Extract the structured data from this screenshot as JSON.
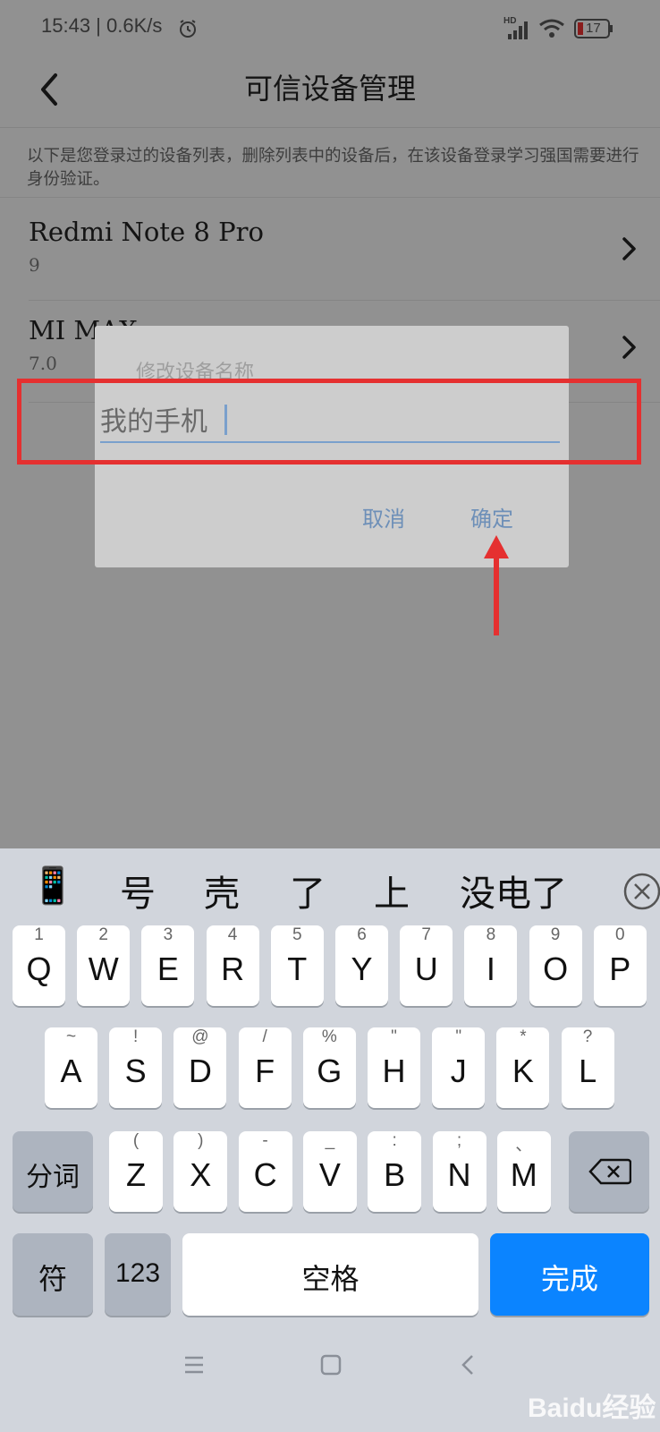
{
  "status_bar": {
    "time": "15:43 | 0.6K/s",
    "battery": "17",
    "network": "HD"
  },
  "header": {
    "title": "可信设备管理"
  },
  "notice": "以下是您登录过的设备列表，删除列表中的设备后，在该设备登录学习强国需要进行身份验证。",
  "devices": [
    {
      "name": "Redmi Note 8 Pro",
      "version": "9"
    },
    {
      "name": "MI MAX",
      "version": "7.0"
    }
  ],
  "dialog": {
    "title": "修改设备名称",
    "input_value": "我的手机",
    "cancel_label": "取消",
    "ok_label": "确定"
  },
  "keyboard": {
    "candidates": [
      "📱",
      "号",
      "壳",
      "了",
      "上",
      "没电了"
    ],
    "row1": [
      {
        "k": "Q",
        "s": "1"
      },
      {
        "k": "W",
        "s": "2"
      },
      {
        "k": "E",
        "s": "3"
      },
      {
        "k": "R",
        "s": "4"
      },
      {
        "k": "T",
        "s": "5"
      },
      {
        "k": "Y",
        "s": "6"
      },
      {
        "k": "U",
        "s": "7"
      },
      {
        "k": "I",
        "s": "8"
      },
      {
        "k": "O",
        "s": "9"
      },
      {
        "k": "P",
        "s": "0"
      }
    ],
    "row2": [
      {
        "k": "A",
        "s": "~"
      },
      {
        "k": "S",
        "s": "!"
      },
      {
        "k": "D",
        "s": "@"
      },
      {
        "k": "F",
        "s": "/"
      },
      {
        "k": "G",
        "s": "%"
      },
      {
        "k": "H",
        "s": "\""
      },
      {
        "k": "J",
        "s": "\""
      },
      {
        "k": "K",
        "s": "*"
      },
      {
        "k": "L",
        "s": "?"
      }
    ],
    "row3": [
      {
        "k": "Z",
        "s": "("
      },
      {
        "k": "X",
        "s": ")"
      },
      {
        "k": "C",
        "s": "-"
      },
      {
        "k": "V",
        "s": "_"
      },
      {
        "k": "B",
        "s": ":"
      },
      {
        "k": "N",
        "s": ";"
      },
      {
        "k": "M",
        "s": "、"
      }
    ],
    "segment_label": "分词",
    "symbol_label": "符",
    "num_label": "123",
    "space_label": "空格",
    "done_label": "完成"
  },
  "watermark": "Baidu经验",
  "colors": {
    "accent": "#0b84ff",
    "annotation": "#e53030",
    "link": "#6d8fb8"
  }
}
